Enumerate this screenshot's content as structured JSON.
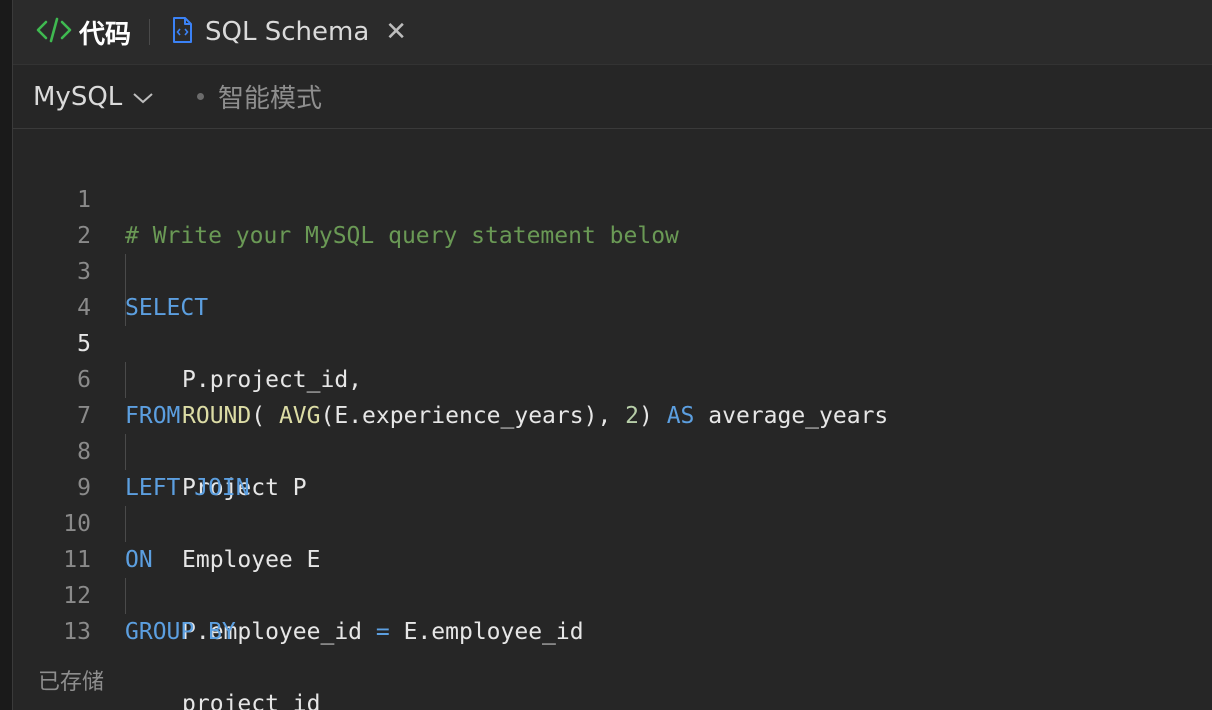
{
  "tabs": {
    "code_label": "代码",
    "schema_label": "SQL Schema"
  },
  "toolbar": {
    "language": "MySQL",
    "mode": "智能模式"
  },
  "editor": {
    "lines": [
      {
        "n": "1",
        "comment": "# Write your MySQL query statement below"
      },
      {
        "n": "2"
      },
      {
        "n": "3",
        "kw": "SELECT"
      },
      {
        "n": "4",
        "text": "P.project_id,"
      },
      {
        "n": "5",
        "fn1": "ROUND",
        "t1": "( ",
        "fn2": "AVG",
        "t2": "(E.experience_years), ",
        "num": "2",
        "t3": ") ",
        "kw": "AS",
        "t4": " average_years"
      },
      {
        "n": "6",
        "kw": "FROM"
      },
      {
        "n": "7",
        "text": "Project P"
      },
      {
        "n": "8",
        "kw": "LEFT JOIN"
      },
      {
        "n": "9",
        "text": "Employee E"
      },
      {
        "n": "10",
        "kw": "ON"
      },
      {
        "n": "11",
        "t1": "P.employee_id ",
        "op": "=",
        "t2": " E.employee_id"
      },
      {
        "n": "12",
        "kw": "GROUP BY"
      },
      {
        "n": "13",
        "text": "project_id"
      }
    ]
  },
  "status": {
    "saved": "已存储"
  },
  "colors": {
    "keyword": "#5c9fe0",
    "function": "#dcdca5",
    "number": "#b7cea8",
    "comment": "#6a9955",
    "code_icon": "#3fb950",
    "file_icon": "#3b82f6"
  }
}
